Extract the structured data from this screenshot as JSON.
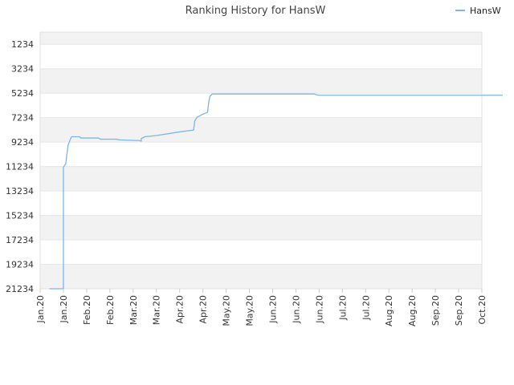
{
  "chart_data": {
    "type": "line",
    "title": "Ranking History for HansW",
    "legend": {
      "position": "top-right"
    },
    "y_reversed": true,
    "ylim": [
      21234,
      234
    ],
    "y_ticks": [
      "1234",
      "3234",
      "5234",
      "7234",
      "9234",
      "11234",
      "13234",
      "15234",
      "17234",
      "19234",
      "21234"
    ],
    "x_ticks": [
      "Jan.20",
      "Jan.20",
      "Feb.20",
      "Feb.20",
      "Mar.20",
      "Mar.20",
      "Apr.20",
      "Apr.20",
      "May.20",
      "May.20",
      "Jun.20",
      "Jun.20",
      "Jun.20",
      "Jul.20",
      "Jul.20",
      "Aug.20",
      "Aug.20",
      "Sep.20",
      "Sep.20",
      "Oct.20"
    ],
    "colors": {
      "series": "#7cb5ec",
      "band": "#f2f2f2",
      "grid": "#e6e6e6"
    },
    "series": [
      {
        "name": "HansW",
        "points": [
          [
            0.4,
            21234
          ],
          [
            1.0,
            21234
          ],
          [
            1.0,
            11300
          ],
          [
            1.1,
            11000
          ],
          [
            1.2,
            9500
          ],
          [
            1.3,
            9000
          ],
          [
            1.35,
            8800
          ],
          [
            1.7,
            8800
          ],
          [
            1.75,
            8900
          ],
          [
            2.5,
            8900
          ],
          [
            2.6,
            9000
          ],
          [
            3.3,
            9000
          ],
          [
            3.4,
            9050
          ],
          [
            4.1,
            9100
          ],
          [
            4.25,
            9100
          ],
          [
            4.35,
            9150
          ],
          [
            4.35,
            8950
          ],
          [
            4.5,
            8800
          ],
          [
            5.0,
            8700
          ],
          [
            6.0,
            8400
          ],
          [
            6.4,
            8300
          ],
          [
            6.6,
            8250
          ],
          [
            6.65,
            7500
          ],
          [
            6.75,
            7200
          ],
          [
            7.0,
            6950
          ],
          [
            7.2,
            6800
          ],
          [
            7.25,
            6000
          ],
          [
            7.3,
            5500
          ],
          [
            7.4,
            5300
          ],
          [
            8.0,
            5300
          ],
          [
            11.8,
            5300
          ],
          [
            11.85,
            5350
          ],
          [
            12.0,
            5400
          ],
          [
            19.9,
            5400
          ]
        ]
      }
    ]
  }
}
